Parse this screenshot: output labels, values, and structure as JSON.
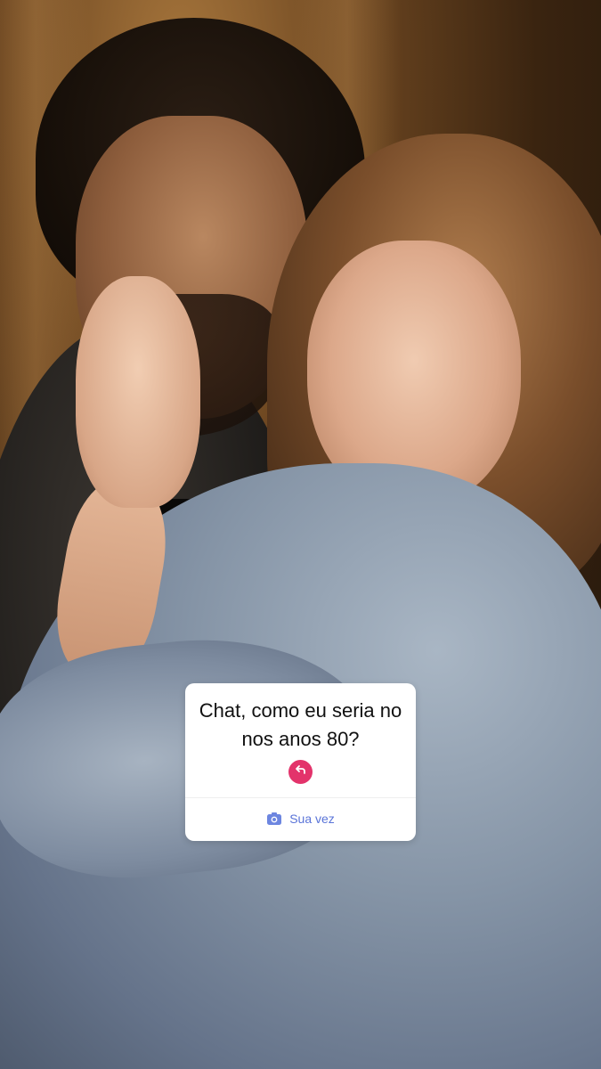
{
  "story": {
    "question_sticker": {
      "question": "Chat, como eu seria no nos anos 80?",
      "reply_icon": "reply-arrow-icon",
      "your_turn_label": "Sua vez",
      "your_turn_icon": "camera-icon"
    }
  },
  "colors": {
    "reply_badge": "#e3336b",
    "your_turn_text": "#5a74d8",
    "sticker_bg": "#ffffff"
  }
}
